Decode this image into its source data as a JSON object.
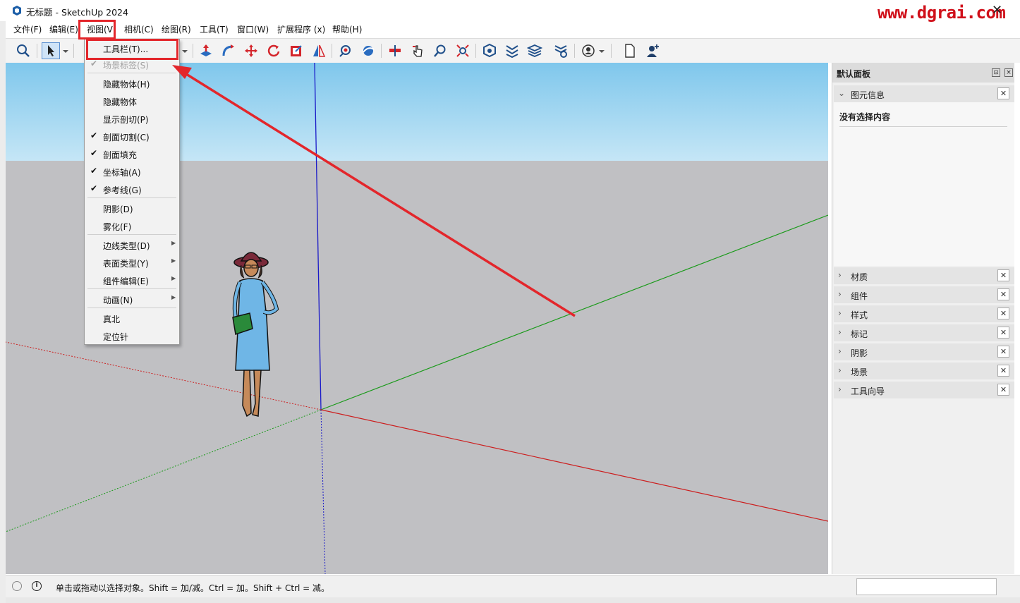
{
  "window": {
    "title": "无标题 - SketchUp 2024",
    "watermark": "www.dgrai.com",
    "close_symbol": "✕"
  },
  "menubar": [
    {
      "label": "文件(F)"
    },
    {
      "label": "编辑(E)"
    },
    {
      "label": "视图(V)"
    },
    {
      "label": "相机(C)"
    },
    {
      "label": "绘图(R)"
    },
    {
      "label": "工具(T)"
    },
    {
      "label": "窗口(W)"
    },
    {
      "label": "扩展程序 (x)"
    },
    {
      "label": "帮助(H)"
    }
  ],
  "toolbar": {
    "icons": [
      "zoom-icon",
      "select-arrow-icon",
      "dropdown-icon",
      "eraser-icon",
      "push-pull-icon",
      "follow-me-icon",
      "move-icon",
      "rotate-icon",
      "scale-icon",
      "flip-icon",
      "paint-icon",
      "orbit-icon",
      "walk-icon",
      "look-around-icon",
      "zoom-window-icon",
      "zoom-extents-icon",
      "3d-warehouse-icon",
      "extension-warehouse-icon",
      "layout-icon",
      "extension-manager-icon",
      "account-icon",
      "new-file-icon",
      "add-user-icon"
    ]
  },
  "view_menu": {
    "items": [
      {
        "label": "工具栏(T)...",
        "checked": false,
        "submenu": false,
        "disabled": false
      },
      {
        "label": "场景标签(S)",
        "checked": true,
        "submenu": false,
        "disabled": true
      },
      {
        "label": "隐藏物体(H)",
        "checked": false,
        "submenu": false,
        "disabled": false
      },
      {
        "label": "隐藏物体",
        "checked": false,
        "submenu": false,
        "disabled": false
      },
      {
        "label": "显示剖切(P)",
        "checked": false,
        "submenu": false,
        "disabled": false
      },
      {
        "label": "剖面切割(C)",
        "checked": true,
        "submenu": false,
        "disabled": false
      },
      {
        "label": "剖面填充",
        "checked": true,
        "submenu": false,
        "disabled": false
      },
      {
        "label": "坐标轴(A)",
        "checked": true,
        "submenu": false,
        "disabled": false
      },
      {
        "label": "参考线(G)",
        "checked": true,
        "submenu": false,
        "disabled": false
      },
      {
        "label": "阴影(D)",
        "checked": false,
        "submenu": false,
        "disabled": false
      },
      {
        "label": "雾化(F)",
        "checked": false,
        "submenu": false,
        "disabled": false
      },
      {
        "label": "边线类型(D)",
        "checked": false,
        "submenu": true,
        "disabled": false
      },
      {
        "label": "表面类型(Y)",
        "checked": false,
        "submenu": true,
        "disabled": false
      },
      {
        "label": "组件编辑(E)",
        "checked": false,
        "submenu": true,
        "disabled": false
      },
      {
        "label": "动画(N)",
        "checked": false,
        "submenu": true,
        "disabled": false
      },
      {
        "label": "真北",
        "checked": false,
        "submenu": false,
        "disabled": false
      },
      {
        "label": "定位针",
        "checked": false,
        "submenu": false,
        "disabled": false
      }
    ],
    "check_mark": "✔",
    "submenu_arrow": "▶"
  },
  "tray": {
    "title": "默认面板",
    "entity_info": {
      "label": "图元信息",
      "empty_text": "没有选择内容"
    },
    "panels": [
      {
        "label": "材质"
      },
      {
        "label": "组件"
      },
      {
        "label": "样式"
      },
      {
        "label": "标记"
      },
      {
        "label": "阴影"
      },
      {
        "label": "场景"
      },
      {
        "label": "工具向导"
      }
    ],
    "panel_close": "✕",
    "collapsed_chevron": "›",
    "expanded_chevron": "⌄"
  },
  "status": {
    "text": "单击或拖动以选择对象。Shift = 加/减。Ctrl = 加。Shift + Ctrl = 减。",
    "measurements_value": ""
  },
  "colors": {
    "highlight": "#e3262b",
    "axis_red": "#cc1e1e",
    "axis_green": "#1a9a1a",
    "axis_blue": "#1a1ac8",
    "sky": "#9fd6f1",
    "ground": "#c0c0c3"
  }
}
